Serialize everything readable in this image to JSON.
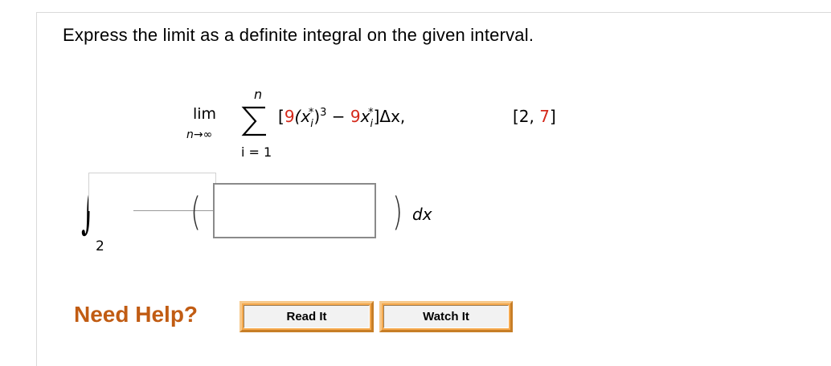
{
  "question": {
    "prompt": "Express the limit as a definite integral on the given interval."
  },
  "limit_expression": {
    "lim_word": "lim",
    "lim_sub_n": "n",
    "lim_sub_arrow_inf": "→∞",
    "sum_top": "n",
    "sum_bottom": "i = 1",
    "term_open": "[",
    "coef_9a": "9",
    "paren_x": "(x",
    "sub_i_1": "i",
    "star_1": "*",
    "close_paren_cube": ")",
    "cube": "3",
    "minus": " − ",
    "coef_9b": "9",
    "x2": "x",
    "sub_i_2": "i",
    "star_2": "*",
    "close_bracket": "]",
    "delta_x": "Δx,",
    "interval_open": "[2, ",
    "interval_upper": "7",
    "interval_close": "]"
  },
  "integral": {
    "symbol": "∫",
    "lower_limit": "2",
    "upper_limit_value": "",
    "integrand_value": "",
    "open_paren": "(",
    "close_paren": ")",
    "differential": "dx"
  },
  "help": {
    "label": "Need Help?",
    "read_button": "Read It",
    "watch_button": "Watch It"
  },
  "colors": {
    "red_coefficient": "#d4281a",
    "need_help": "#c15c13",
    "button_orange": "#f5a94e"
  }
}
